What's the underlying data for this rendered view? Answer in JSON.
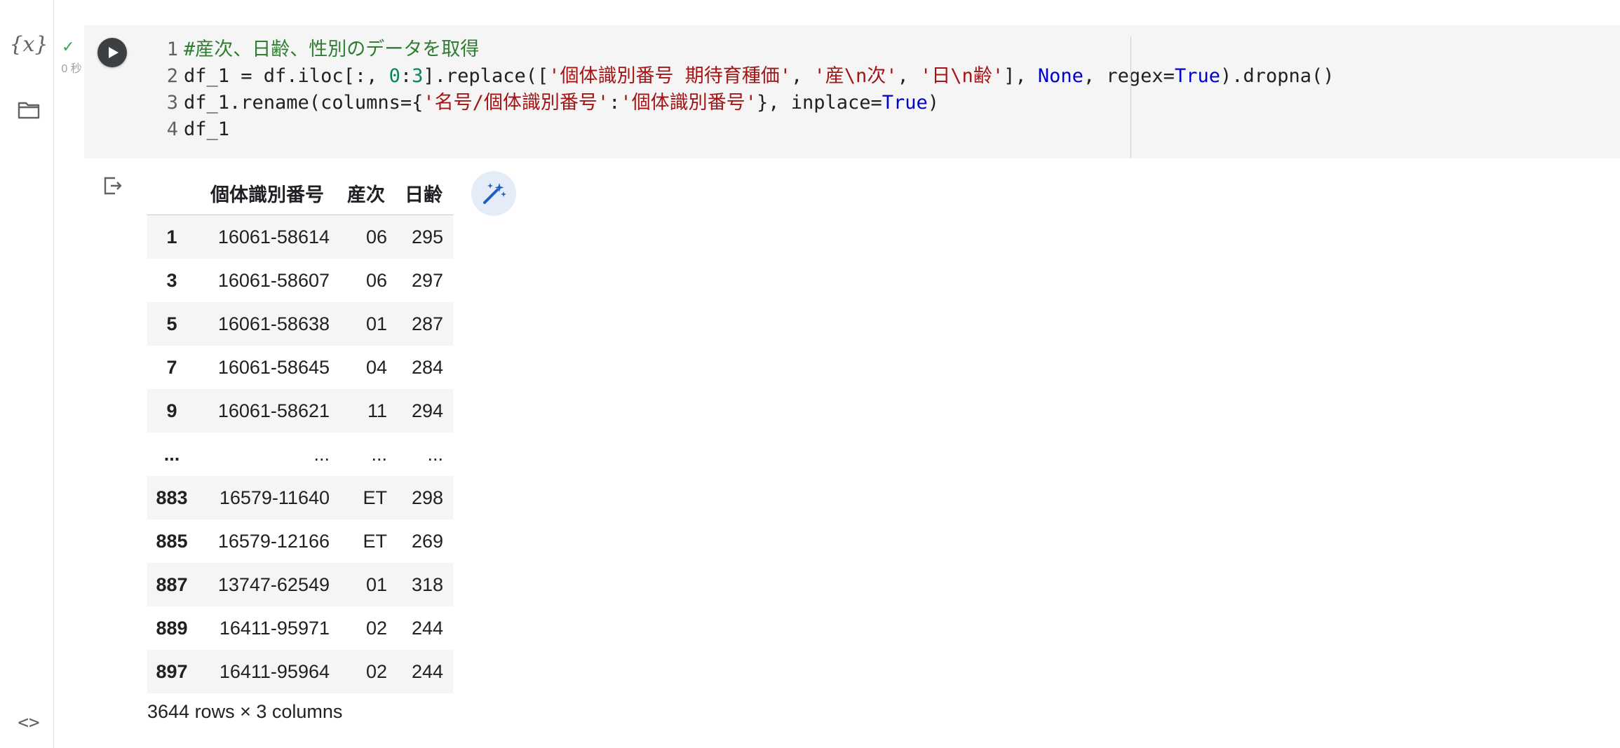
{
  "cell": {
    "status_time": "0 秒",
    "code_lines": [
      {
        "num": "1",
        "tokens": [
          {
            "t": "comment",
            "v": "#産次、日齢、性別のデータを取得"
          }
        ]
      },
      {
        "num": "2",
        "tokens": [
          {
            "t": "plain",
            "v": "df_1 = df.iloc[:, "
          },
          {
            "t": "num",
            "v": "0"
          },
          {
            "t": "plain",
            "v": ":"
          },
          {
            "t": "num",
            "v": "3"
          },
          {
            "t": "plain",
            "v": "].replace(["
          },
          {
            "t": "str",
            "v": "'個体識別番号 期待育種価'"
          },
          {
            "t": "plain",
            "v": ", "
          },
          {
            "t": "str",
            "v": "'産\\n次'"
          },
          {
            "t": "plain",
            "v": ", "
          },
          {
            "t": "str",
            "v": "'日\\n齢'"
          },
          {
            "t": "plain",
            "v": "], "
          },
          {
            "t": "kw",
            "v": "None"
          },
          {
            "t": "plain",
            "v": ", regex="
          },
          {
            "t": "kw",
            "v": "True"
          },
          {
            "t": "plain",
            "v": ").dropna()"
          }
        ]
      },
      {
        "num": "3",
        "tokens": [
          {
            "t": "plain",
            "v": "df_1.rename(columns={"
          },
          {
            "t": "str",
            "v": "'名号/個体識別番号'"
          },
          {
            "t": "plain",
            "v": ":"
          },
          {
            "t": "str",
            "v": "'個体識別番号'"
          },
          {
            "t": "plain",
            "v": "}, inplace="
          },
          {
            "t": "kw",
            "v": "True"
          },
          {
            "t": "plain",
            "v": ")"
          }
        ]
      },
      {
        "num": "4",
        "tokens": [
          {
            "t": "plain",
            "v": "df_1"
          }
        ]
      }
    ]
  },
  "output": {
    "columns": [
      "",
      "個体識別番号",
      "産次",
      "日齢"
    ],
    "rows": [
      [
        "1",
        "16061-58614",
        "06",
        "295"
      ],
      [
        "3",
        "16061-58607",
        "06",
        "297"
      ],
      [
        "5",
        "16061-58638",
        "01",
        "287"
      ],
      [
        "7",
        "16061-58645",
        "04",
        "284"
      ],
      [
        "9",
        "16061-58621",
        "11",
        "294"
      ],
      [
        "...",
        "...",
        "...",
        "..."
      ],
      [
        "883",
        "16579-11640",
        "ET",
        "298"
      ],
      [
        "885",
        "16579-12166",
        "ET",
        "269"
      ],
      [
        "887",
        "13747-62549",
        "01",
        "318"
      ],
      [
        "889",
        "16411-95971",
        "02",
        "244"
      ],
      [
        "897",
        "16411-95964",
        "02",
        "244"
      ]
    ],
    "summary": "3644 rows × 3 columns"
  },
  "icons": {
    "sidebar": [
      "variables-icon",
      "folder-icon",
      "code-snippets-icon"
    ],
    "variables_glyph": "{x}",
    "code_glyph": "<>",
    "status": "check-icon",
    "run": "play-icon",
    "output": "output-icon",
    "magic": "magic-wand-icon"
  },
  "colors": {
    "comment": "#2e7d32",
    "string": "#a31515",
    "keyword": "#0000cc",
    "number": "#098658",
    "success": "#34a853",
    "cell_bg": "#f5f5f5"
  }
}
